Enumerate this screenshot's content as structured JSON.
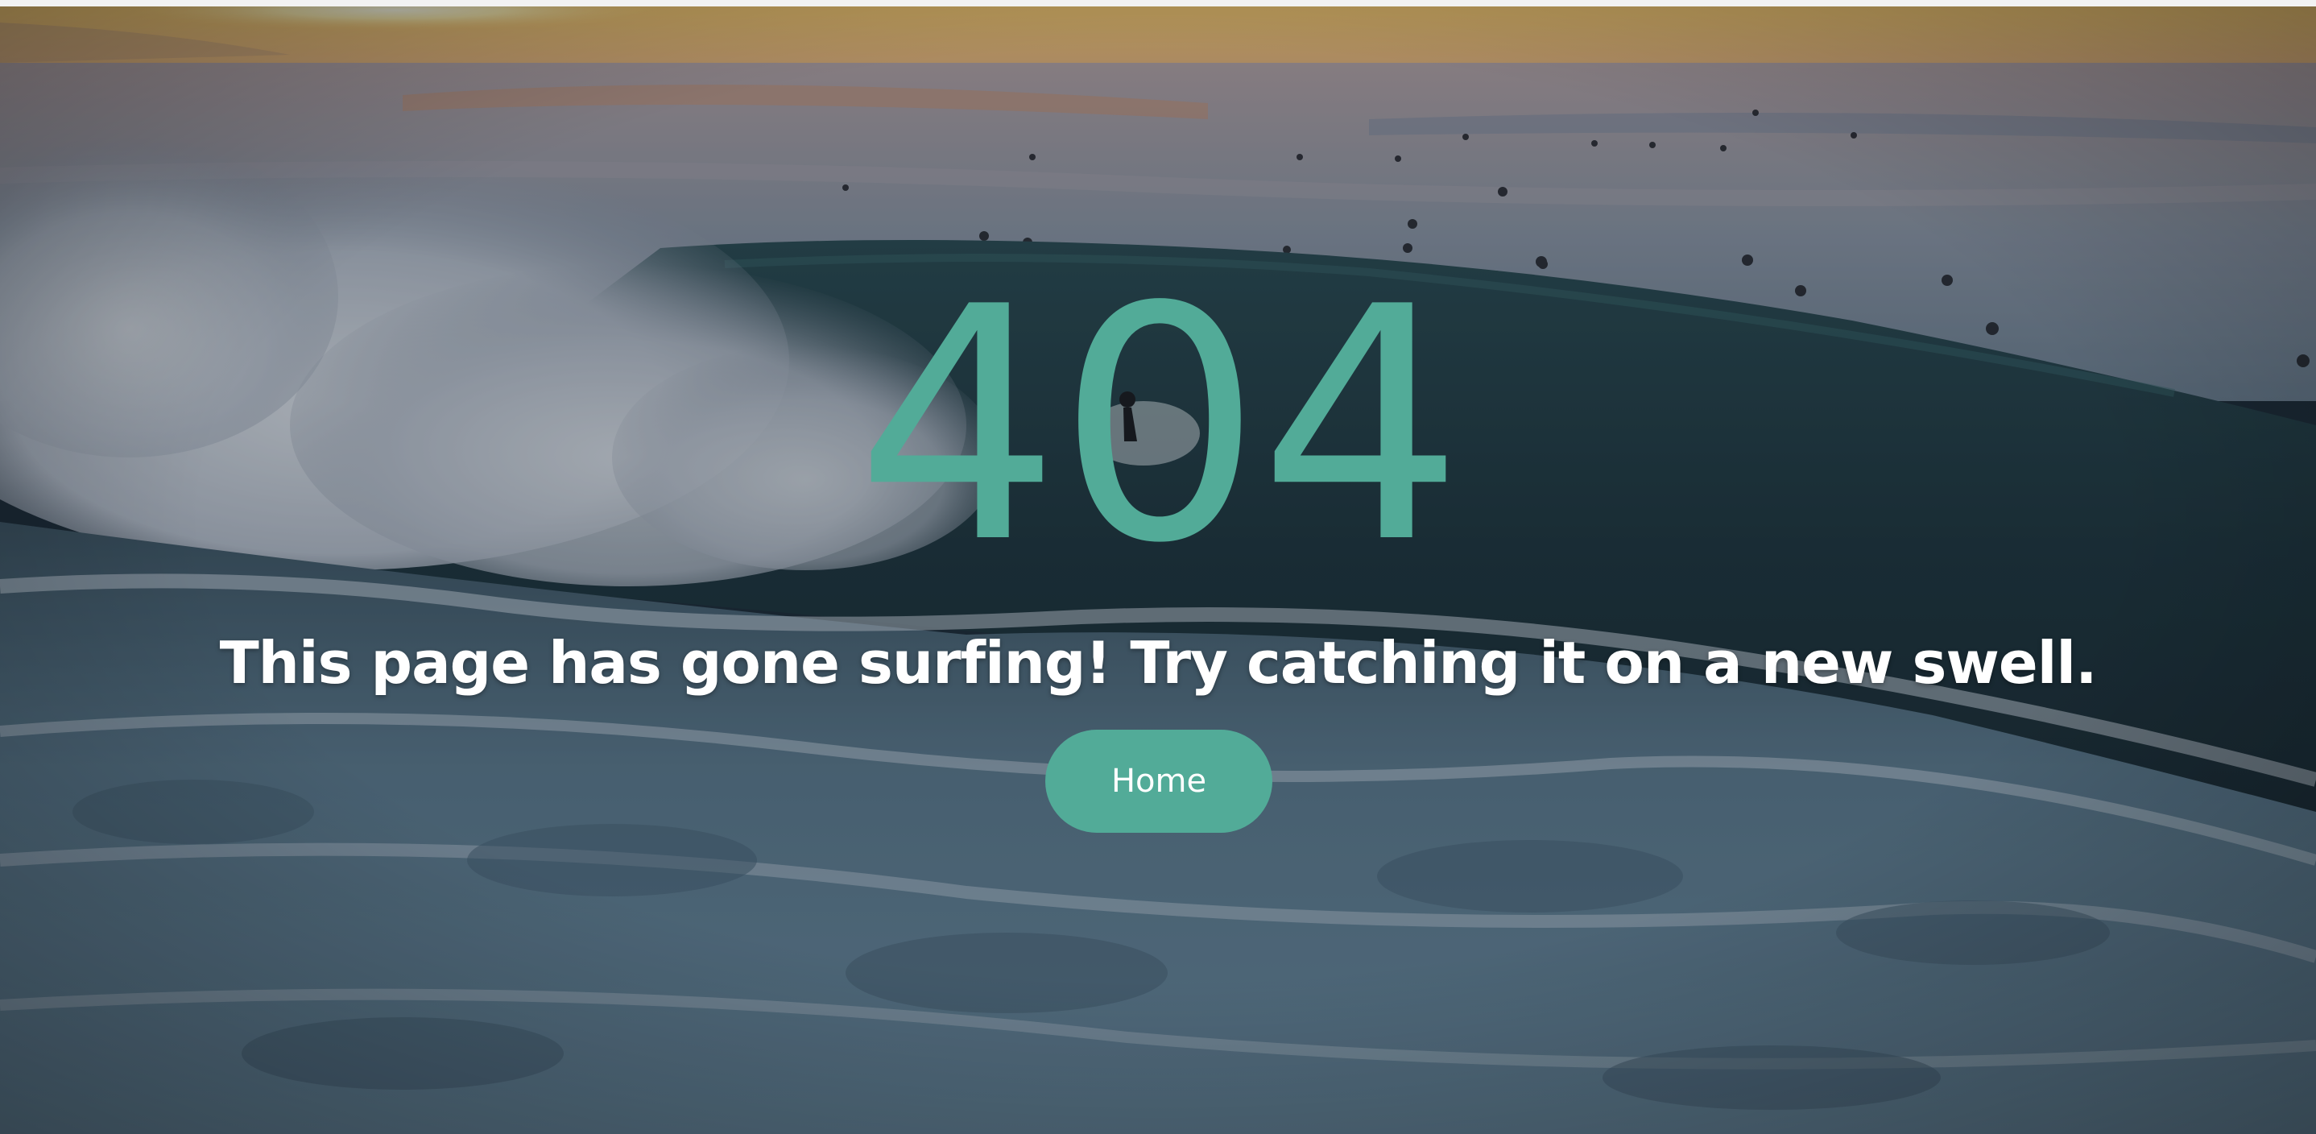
{
  "error": {
    "code": "404",
    "message": "This page has gone surfing! Try catching it on a new swell."
  },
  "actions": {
    "home_label": "Home"
  },
  "background": {
    "image": "ocean-wave-surfer-sunset",
    "overlay": "dark"
  },
  "colors": {
    "accent": "#52ab98",
    "text": "#ffffff"
  }
}
